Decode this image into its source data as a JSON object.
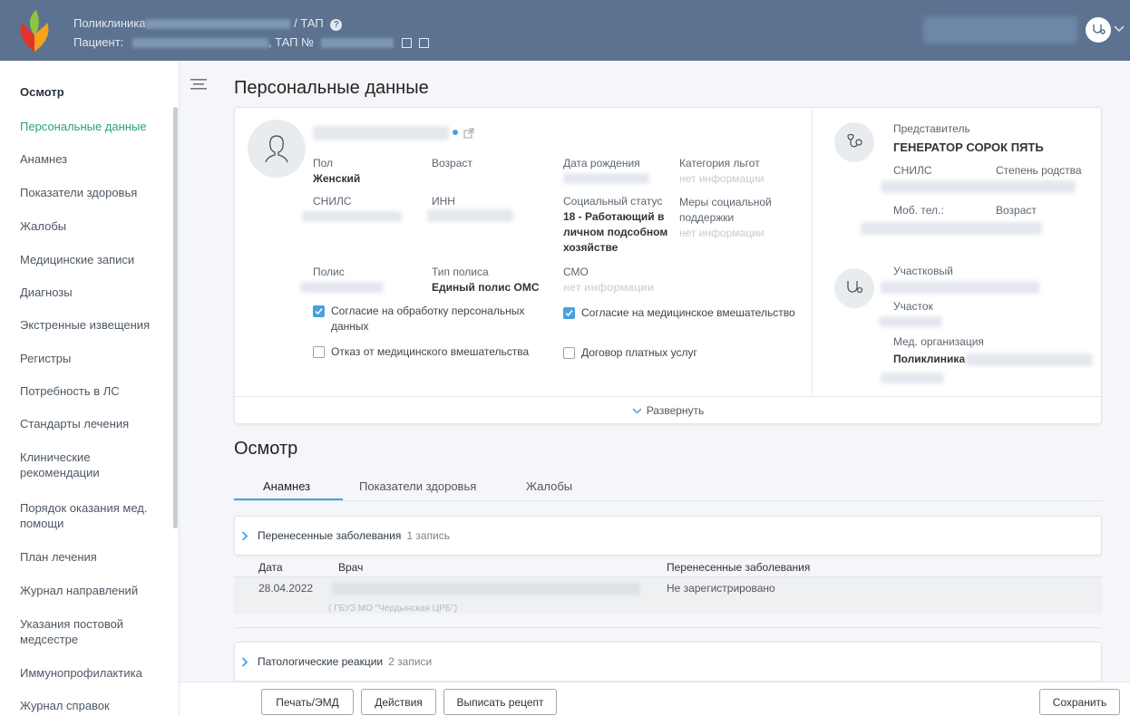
{
  "header": {
    "clinic_label": "Поликлиника",
    "tap_label": "/ ТАП",
    "patient_label": "Пациент:",
    "tap_number_label": ", ТАП №"
  },
  "sidebar": {
    "items": [
      {
        "label": "Осмотр"
      },
      {
        "label": "Персональные данные"
      },
      {
        "label": "Анамнез"
      },
      {
        "label": "Показатели здоровья"
      },
      {
        "label": "Жалобы"
      },
      {
        "label": "Медицинские записи"
      },
      {
        "label": "Диагнозы"
      },
      {
        "label": "Экстренные извещения"
      },
      {
        "label": "Регистры"
      },
      {
        "label": "Потребность в ЛС"
      },
      {
        "label": "Стандарты лечения"
      },
      {
        "label": "Клинические рекомендации"
      },
      {
        "label": "Порядок оказания мед. помощи"
      },
      {
        "label": "План лечения"
      },
      {
        "label": "Журнал направлений"
      },
      {
        "label": "Указания постовой медсестре"
      },
      {
        "label": "Иммунопрофилактика"
      },
      {
        "label": "Журнал справок"
      }
    ]
  },
  "personal": {
    "title": "Персональные данные",
    "sex_label": "Пол",
    "sex_value": "Женский",
    "age_label": "Возраст",
    "birth_label": "Дата рождения",
    "benefit_label": "Категория льгот",
    "benefit_value": "нет информации",
    "snils_label": "СНИЛС",
    "inn_label": "ИНН",
    "social_label": "Социальный статус",
    "social_value": "18 - Работающий в личном подсобном хозяйстве",
    "support_label": "Меры социальной поддержки",
    "support_value": "нет информации",
    "policy_label": "Полис",
    "policy_type_label": "Тип полиса",
    "policy_type_value": "Единый полис ОМС",
    "smo_label": "СМО",
    "smo_value": "нет информации",
    "consent_personal": "Согласие на обработку персональных данных",
    "consent_medical": "Согласие на медицинское вмешательство",
    "refusal": "Отказ от медицинского вмешательства",
    "paid_contract": "Договор платных услуг",
    "expand_label": "Развернуть"
  },
  "representative": {
    "title": "Представитель",
    "name": "ГЕНЕРАТОР СОРОК ПЯТЬ",
    "snils_label": "СНИЛС",
    "relation_label": "Степень родства",
    "phone_label": "Моб. тел.:",
    "age_label": "Возраст"
  },
  "district": {
    "doctor_label": "Участковый",
    "area_label": "Участок",
    "org_label": "Мед. организация",
    "org_value": "Поликлиника"
  },
  "exam": {
    "title": "Осмотр",
    "tabs": [
      {
        "label": "Анамнез"
      },
      {
        "label": "Показатели здоровья"
      },
      {
        "label": "Жалобы"
      }
    ],
    "diseases": {
      "title": "Перенесенные заболевания",
      "count": "1 запись",
      "columns": [
        "Дата",
        "Врач",
        "Перенесенные заболевания"
      ],
      "rows": [
        {
          "date": "28.04.2022",
          "doctor_tail": "( ГБУЗ МО \"Чердынская ЦРБ\")",
          "value": "Не зарегистрировано"
        }
      ]
    },
    "reactions": {
      "title": "Патологические реакции",
      "count": "2 записи"
    }
  },
  "footer": {
    "print_label": "Печать/ЭМД",
    "actions_label": "Действия",
    "prescription_label": "Выписать рецепт",
    "save_label": "Сохранить"
  }
}
